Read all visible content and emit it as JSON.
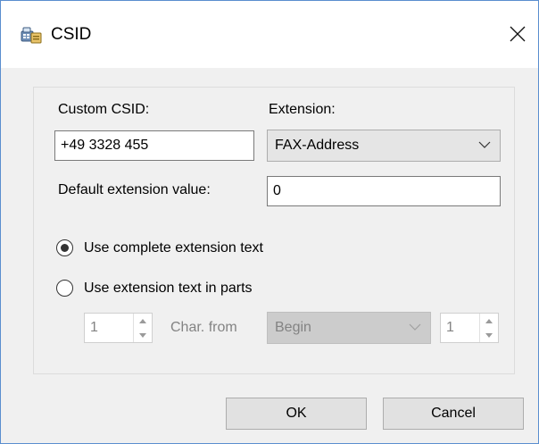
{
  "window": {
    "title": "CSID",
    "close_glyph": "✕",
    "app_icon": "phone-fax-icon"
  },
  "form": {
    "custom_csid_label": "Custom CSID:",
    "custom_csid_value": "+49 3328 455",
    "extension_label": "Extension:",
    "extension_selected": "FAX-Address",
    "default_ext_label": "Default extension value:",
    "default_ext_value": "0"
  },
  "options": {
    "use_complete_label": "Use complete extension text",
    "use_complete_checked": true,
    "use_parts_label": "Use extension text in parts",
    "use_parts_checked": false
  },
  "parts": {
    "start_value": "1",
    "char_from_label": "Char. from",
    "position_selected": "Begin",
    "length_value": "1"
  },
  "buttons": {
    "ok_label": "OK",
    "cancel_label": "Cancel"
  },
  "colors": {
    "window_border": "#5a8ecf",
    "dialog_bg": "#f0f0f0",
    "disabled_text": "#838383"
  }
}
